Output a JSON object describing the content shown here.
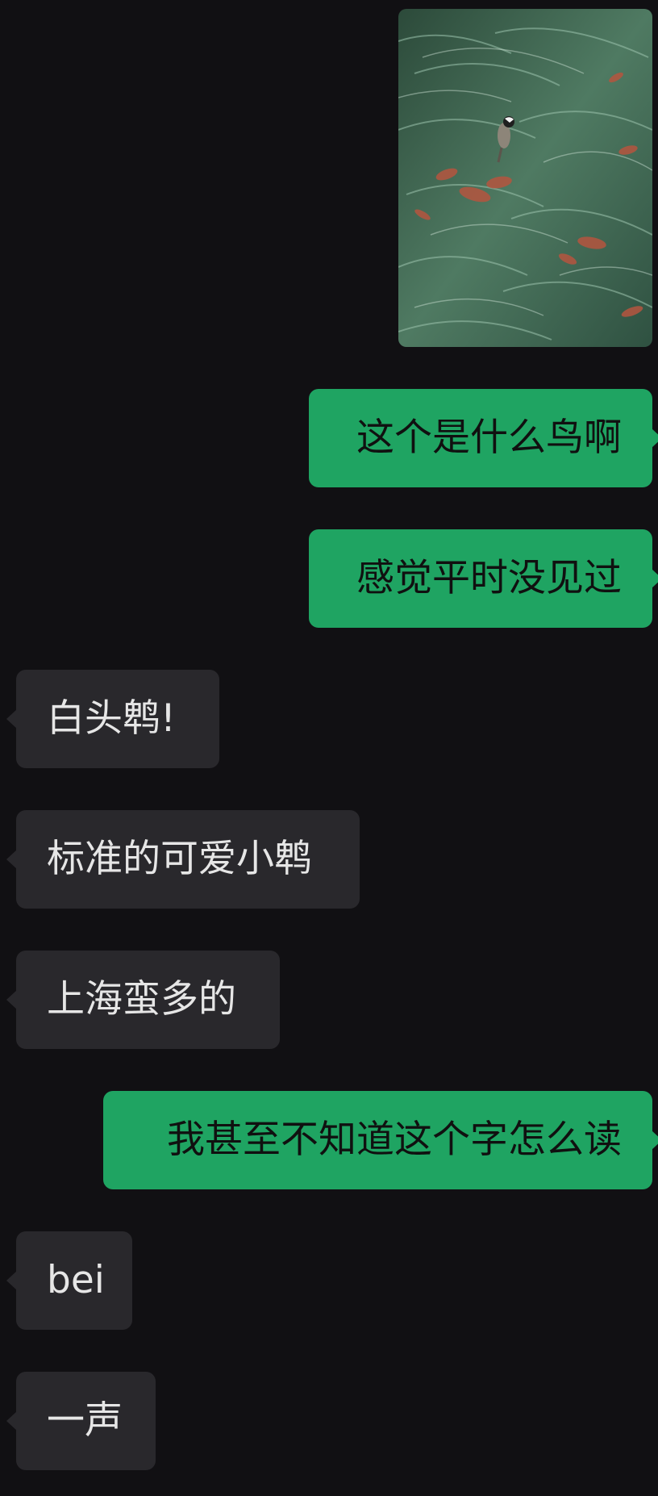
{
  "theme": {
    "background": "#111013",
    "outgoing_bubble": "#1fa462",
    "incoming_bubble": "#29282c"
  },
  "messages": [
    {
      "direction": "outgoing",
      "type": "image",
      "image_subject": "bird-in-grass-photo"
    },
    {
      "direction": "outgoing",
      "type": "text",
      "text": "这个是什么鸟啊"
    },
    {
      "direction": "outgoing",
      "type": "text",
      "text": "感觉平时没见过"
    },
    {
      "direction": "incoming",
      "type": "text",
      "text": "白头鹎!"
    },
    {
      "direction": "incoming",
      "type": "text",
      "text": "标准的可爱小鹎"
    },
    {
      "direction": "incoming",
      "type": "text",
      "text": "上海蛮多的"
    },
    {
      "direction": "outgoing",
      "type": "text",
      "text": "我甚至不知道这个字怎么读"
    },
    {
      "direction": "incoming",
      "type": "text",
      "text": "bei"
    },
    {
      "direction": "incoming",
      "type": "text",
      "text": "一声"
    }
  ]
}
